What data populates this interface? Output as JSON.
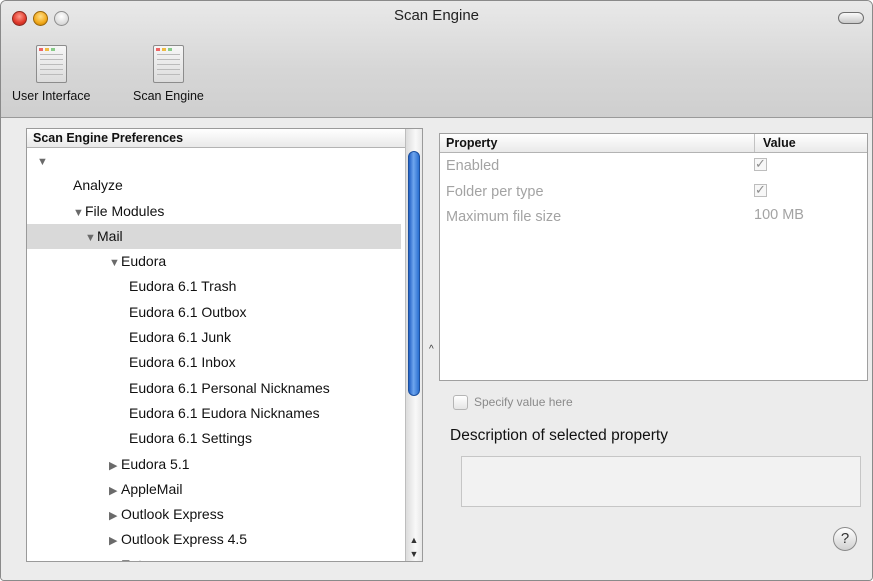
{
  "window": {
    "title": "Scan Engine"
  },
  "toolbar": {
    "items": [
      {
        "label": "User Interface"
      },
      {
        "label": "Scan Engine"
      }
    ]
  },
  "tree": {
    "header": "Scan Engine Preferences",
    "rows": [
      {
        "label": "",
        "expanded": true,
        "depth": 0,
        "triangle": "▼"
      },
      {
        "label": "Analyze",
        "depth": 1,
        "triangle": ""
      },
      {
        "label": "File Modules",
        "depth": 1,
        "triangle": "▼"
      },
      {
        "label": "Mail",
        "depth": 2,
        "triangle": "▼",
        "selected": true
      },
      {
        "label": "Eudora",
        "depth": 3,
        "triangle": "▼"
      },
      {
        "label": "Eudora 6.1 Trash",
        "depth": 4,
        "triangle": ""
      },
      {
        "label": "Eudora 6.1 Outbox",
        "depth": 4,
        "triangle": ""
      },
      {
        "label": "Eudora 6.1 Junk",
        "depth": 4,
        "triangle": ""
      },
      {
        "label": "Eudora 6.1 Inbox",
        "depth": 4,
        "triangle": ""
      },
      {
        "label": "Eudora 6.1 Personal Nicknames",
        "depth": 4,
        "triangle": ""
      },
      {
        "label": "Eudora 6.1 Eudora Nicknames",
        "depth": 4,
        "triangle": ""
      },
      {
        "label": "Eudora 6.1 Settings",
        "depth": 4,
        "triangle": ""
      },
      {
        "label": "Eudora 5.1",
        "depth": 3,
        "triangle": "▶"
      },
      {
        "label": "AppleMail",
        "depth": 3,
        "triangle": "▶"
      },
      {
        "label": "Outlook Express",
        "depth": 3,
        "triangle": "▶"
      },
      {
        "label": "Outlook Express 4.5",
        "depth": 3,
        "triangle": "▶"
      },
      {
        "label": "Entourage",
        "depth": 3,
        "triangle": "▶"
      }
    ]
  },
  "properties": {
    "col_property": "Property",
    "col_value": "Value",
    "rows": [
      {
        "name": "Enabled",
        "value": "✓",
        "type": "checkbox"
      },
      {
        "name": "Folder per type",
        "value": "✓",
        "type": "checkbox"
      },
      {
        "name": "Maximum file size",
        "value": "100 MB",
        "type": "text"
      }
    ]
  },
  "specify_label": "Specify value here",
  "description_label": "Description of selected property",
  "help_label": "?"
}
